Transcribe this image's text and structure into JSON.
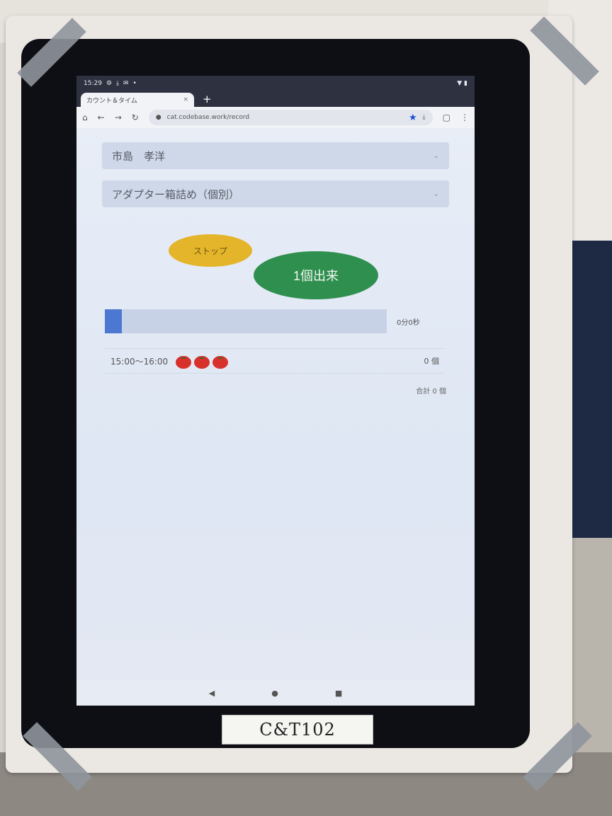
{
  "status_bar": {
    "time": "15:29",
    "left_icons": [
      "gear-icon",
      "download-icon",
      "mail-icon",
      "notification-icon"
    ],
    "right_icons": [
      "wifi-icon",
      "battery-icon"
    ]
  },
  "browser": {
    "tab_title": "カウント＆タイム",
    "tab_close": "×",
    "new_tab": "+",
    "url": "cat.codebase.work/record"
  },
  "form": {
    "worker_select": "市島　孝洋",
    "task_select": "アダプター箱詰め（個別）"
  },
  "buttons": {
    "stop": "ストップ",
    "done": "1個出来"
  },
  "progress": {
    "fraction": 0.06,
    "timer": "0分0秒"
  },
  "slot": {
    "time_range": "15:00～16:00",
    "tomato_count": 3,
    "count": "0 個"
  },
  "total": "合計 0 個",
  "device_label": "C&T102",
  "colors": {
    "stop_button": "#e4b52a",
    "done_button": "#2f8f4e",
    "progress_fill": "#4d78d2",
    "tomato": "#d8302a"
  }
}
